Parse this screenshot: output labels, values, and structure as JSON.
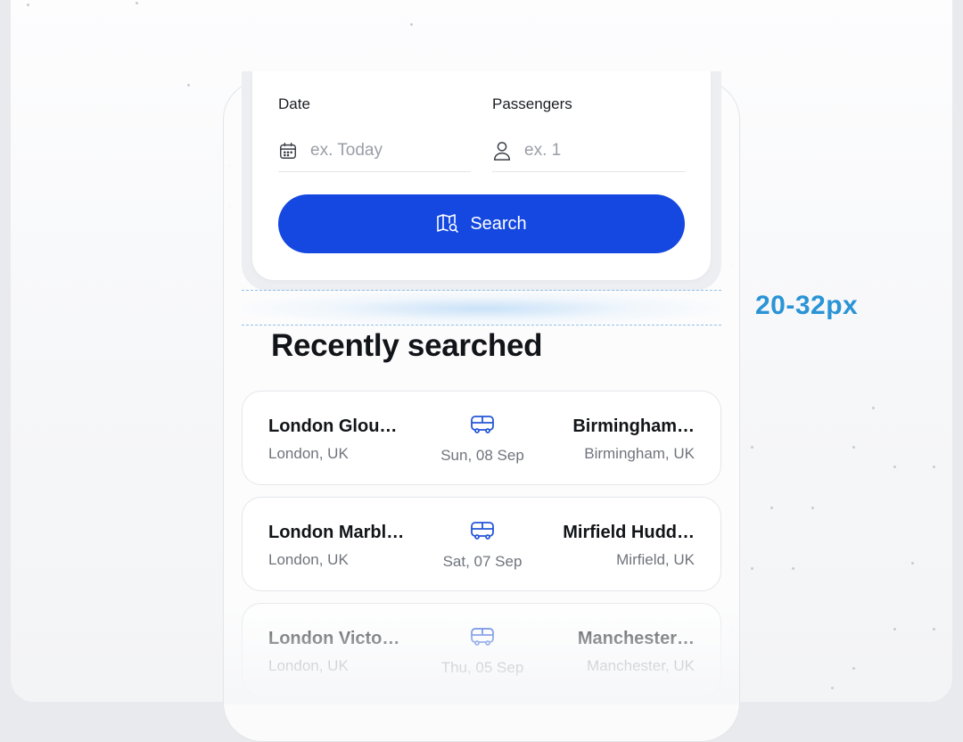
{
  "form": {
    "date": {
      "label": "Date",
      "placeholder": "ex. Today",
      "icon": "calendar-icon"
    },
    "passengers": {
      "label": "Passengers",
      "placeholder": "ex. 1",
      "icon": "user-icon"
    },
    "search_button": {
      "label": "Search",
      "icon": "map-search-icon",
      "color": "#1448e0"
    }
  },
  "annotation": {
    "spacing_label": "20-32px",
    "color": "#2a94d6"
  },
  "recent": {
    "title": "Recently searched",
    "items": [
      {
        "from_name": "London Glou…",
        "from_city": "London, UK",
        "date": "Sun, 08 Sep",
        "to_name": "Birmingham…",
        "to_city": "Birmingham, UK",
        "icon": "bus-icon"
      },
      {
        "from_name": "London Marbl…",
        "from_city": "London, UK",
        "date": "Sat, 07 Sep",
        "to_name": "Mirfield Hudd…",
        "to_city": "Mirfield, UK",
        "icon": "bus-icon"
      },
      {
        "from_name": "London Victo…",
        "from_city": "London, UK",
        "date": "Thu, 05 Sep",
        "to_name": "Manchester…",
        "to_city": "Manchester, UK",
        "icon": "bus-icon"
      }
    ]
  }
}
